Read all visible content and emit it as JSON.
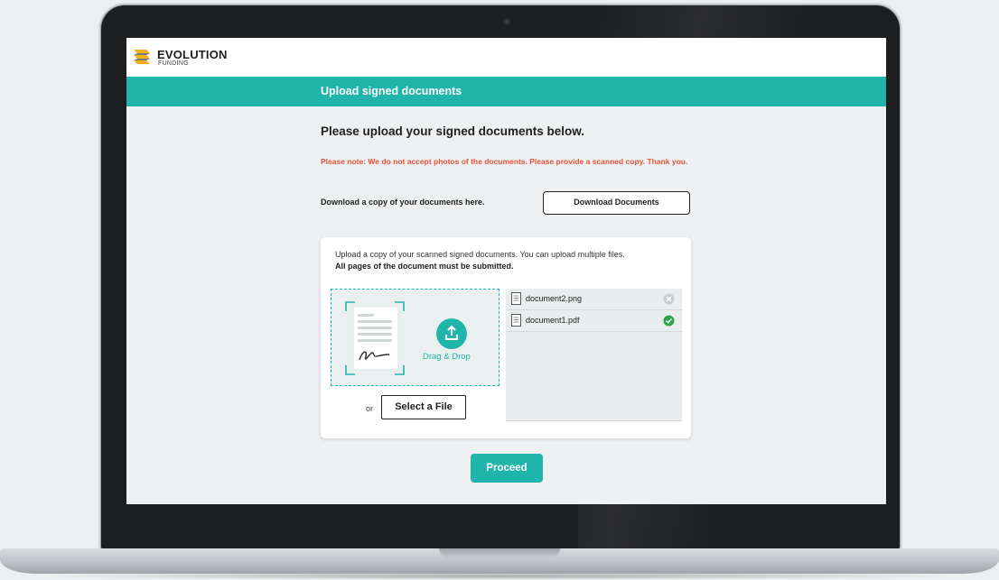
{
  "brand": {
    "name": "EVOLUTION",
    "sub": "FUNDING",
    "accent": "#1fb5ab",
    "logo_color": "#f2b01e"
  },
  "title_bar": {
    "title": "Upload signed documents"
  },
  "main": {
    "heading": "Please upload your signed documents below.",
    "note": "Please note: We do not accept photos of the documents. Please provide a scanned copy. Thank you.",
    "download_label": "Download a copy of your documents here.",
    "download_button": "Download Documents"
  },
  "upload": {
    "instructions": "Upload a copy of your scanned signed documents. You can upload multiple files.",
    "requirement": "All pages of the document must be submitted.",
    "drag_drop_label": "Drag & Drop",
    "or_label": "or",
    "select_button": "Select a File",
    "files": [
      {
        "name": "document2.png",
        "status": "remove",
        "icon": "remove-icon"
      },
      {
        "name": "document1.pdf",
        "status": "uploaded",
        "icon": "check-icon"
      }
    ]
  },
  "footer": {
    "proceed_button": "Proceed"
  }
}
